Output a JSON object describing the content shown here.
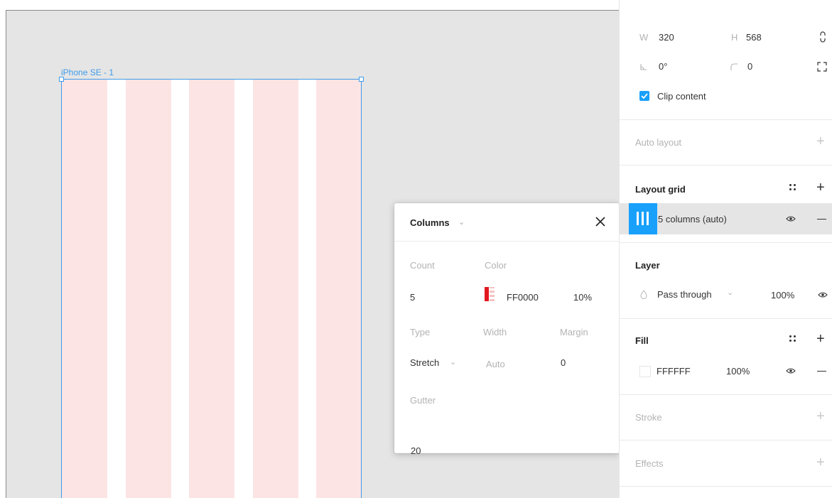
{
  "canvas": {
    "frame_label": "iPhone SE - 1",
    "column_color": "#fde4e4",
    "selection_color": "#3d9bea",
    "column_count": 5
  },
  "popup": {
    "title": "Columns",
    "count_label": "Count",
    "count_value": "5",
    "color_label": "Color",
    "color_hex": "FF0000",
    "color_opacity": "10%",
    "type_label": "Type",
    "type_value": "Stretch",
    "width_label": "Width",
    "width_value": "Auto",
    "margin_label": "Margin",
    "margin_value": "0",
    "gutter_label": "Gutter",
    "gutter_value": "20",
    "swatch_color": "#e2181f"
  },
  "panel": {
    "w_label": "W",
    "w_value": "320",
    "h_label": "H",
    "h_value": "568",
    "rotation_value": "0°",
    "radius_value": "0",
    "clip_content_label": "Clip content",
    "clip_content_checked": true,
    "auto_layout_title": "Auto layout",
    "layout_grid_title": "Layout grid",
    "grid_item_label": "5 columns (auto)",
    "layer_title": "Layer",
    "blend_mode": "Pass through",
    "layer_opacity": "100%",
    "fill_title": "Fill",
    "fill_hex": "FFFFFF",
    "fill_opacity": "100%",
    "stroke_title": "Stroke",
    "effects_title": "Effects",
    "accent_color": "#18a0fb"
  }
}
